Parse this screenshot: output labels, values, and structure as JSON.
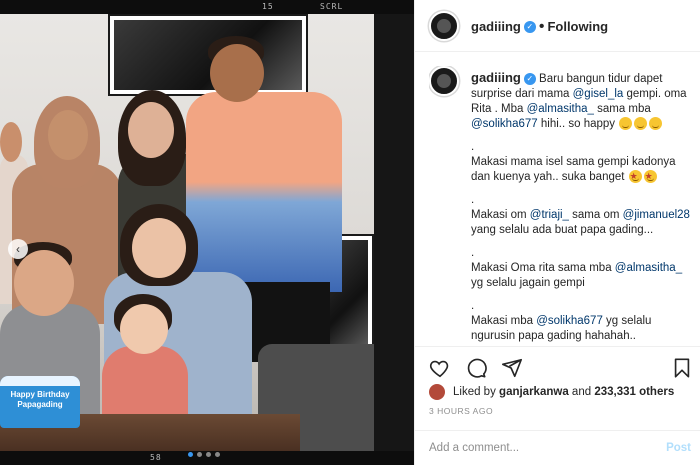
{
  "photo": {
    "top_left_label": "15",
    "top_right_label": "SCRL",
    "bottom_label": "58",
    "cake_text": "Happy Birthday Papagading",
    "carousel_dots": 4,
    "active_dot": 0
  },
  "header": {
    "username": "gadiiing",
    "separator": "•",
    "follow_status": "Following"
  },
  "caption": {
    "username": "gadiiing",
    "lines": [
      {
        "text": "Baru bangun tidur dapet surprise dari mama ",
        "mention": "@gisel_la",
        "after": " gempi. oma Rita . Mba ",
        "mention2": "@almasitha_",
        "after2": " sama mba ",
        "mention3": "@solikha677",
        "after3": " hihi.. so happy"
      },
      {
        "text": "."
      },
      {
        "text": "Makasi mama isel sama gempi kadonya dan kuenya yah.. suka banget"
      },
      {
        "text": "."
      },
      {
        "text": "Makasi om ",
        "mention": "@triaji_",
        "after": " sama om ",
        "mention2": "@jimanuel28",
        "after2": " yang selalu ada buat papa gading..."
      },
      {
        "text": "."
      },
      {
        "text": "Makasi Oma rita sama mba ",
        "mention": "@almasitha_",
        "after": " yg selalu jagain gempi"
      },
      {
        "text": "."
      },
      {
        "text": "Makasi mba ",
        "mention": "@solikha677",
        "after": " yg selalu ngurusin papa gading hahahah.."
      }
    ]
  },
  "actions": {
    "like_icon": "heart-icon",
    "comment_icon": "comment-icon",
    "share_icon": "share-icon",
    "save_icon": "bookmark-icon"
  },
  "likes": {
    "prefix": "Liked by",
    "liker": "ganjarkanwa",
    "middle": "and",
    "count": "233,331 others"
  },
  "timestamp": "3 HOURS AGO",
  "comment": {
    "placeholder": "Add a comment...",
    "post_label": "Post"
  },
  "colors": {
    "accent": "#3897f0",
    "mention": "#00376b",
    "post_disabled": "#b2dffc"
  }
}
